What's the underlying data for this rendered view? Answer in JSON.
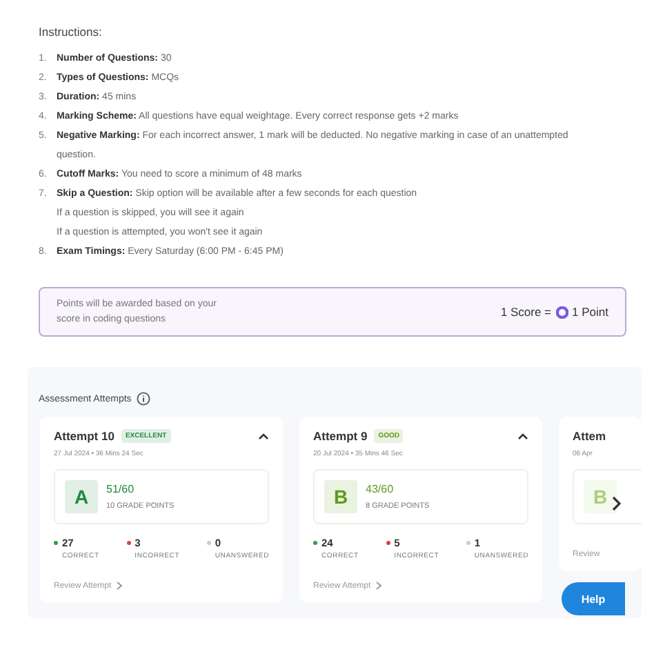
{
  "instructions": {
    "title": "Instructions:",
    "items": [
      {
        "number": "1.",
        "label": "Number of Questions:",
        "text": "30"
      },
      {
        "number": "2.",
        "label": "Types of Questions:",
        "text": "MCQs"
      },
      {
        "number": "3.",
        "label": "Duration:",
        "text": "45 mins"
      },
      {
        "number": "4.",
        "label": "Marking Scheme:",
        "text": "All questions have equal weightage. Every correct response gets +2 marks"
      },
      {
        "number": "5.",
        "label": "Negative Marking:",
        "text": "For each incorrect answer, 1 mark will be deducted. No negative marking in case of an unattempted question."
      },
      {
        "number": "6.",
        "label": "Cutoff Marks:",
        "text": "You need to score a minimum of 48 marks"
      },
      {
        "number": "7.",
        "label": "Skip a Question:",
        "text": "Skip option will be available after a few seconds for each question",
        "notes": [
          "If a question is skipped, you will see it again",
          "If a question is attempted, you won't see it again"
        ]
      },
      {
        "number": "8.",
        "label": "Exam Timings:",
        "text": "Every Saturday (6:00 PM - 6:45 PM)"
      }
    ]
  },
  "points_banner": {
    "text": "Points will be awarded based on your score in coding questions",
    "left": "1 Score =",
    "right": "1 Point"
  },
  "attempts": {
    "title": "Assessment Attempts",
    "cards": [
      {
        "kind": "full",
        "title": "Attempt 10",
        "badge": "EXCELLENT",
        "color": "#1e8a3c",
        "meta": "27 Jul 2024  •  36 Mins 24 Sec",
        "grade": "A",
        "score": "51/60",
        "grade_points": "10 GRADE POINTS",
        "expanded": true,
        "stats": [
          {
            "value": "27",
            "label": "CORRECT",
            "color": "#2e9e50"
          },
          {
            "value": "3",
            "label": "INCORRECT",
            "color": "#d9434b"
          },
          {
            "value": "0",
            "label": "UNANSWERED",
            "color": "#c8ccd2"
          }
        ],
        "review": "Review Attempt"
      },
      {
        "kind": "full",
        "title": "Attempt 9",
        "badge": "GOOD",
        "color": "#5e9a1c",
        "meta": "20 Jul 2024  •  35 Mins 46 Sec",
        "grade": "B",
        "score": "43/60",
        "grade_points": "8 GRADE POINTS",
        "expanded": true,
        "stats": [
          {
            "value": "24",
            "label": "CORRECT",
            "color": "#2e9e50"
          },
          {
            "value": "5",
            "label": "INCORRECT",
            "color": "#d9434b"
          },
          {
            "value": "1",
            "label": "UNANSWERED",
            "color": "#c8ccd2"
          }
        ],
        "review": "Review Attempt"
      },
      {
        "kind": "partial",
        "title": "Attem",
        "color": "#a9cf7a",
        "meta": "06 Apr",
        "grade": "B",
        "review": "Review"
      }
    ]
  },
  "help_button": "Help"
}
